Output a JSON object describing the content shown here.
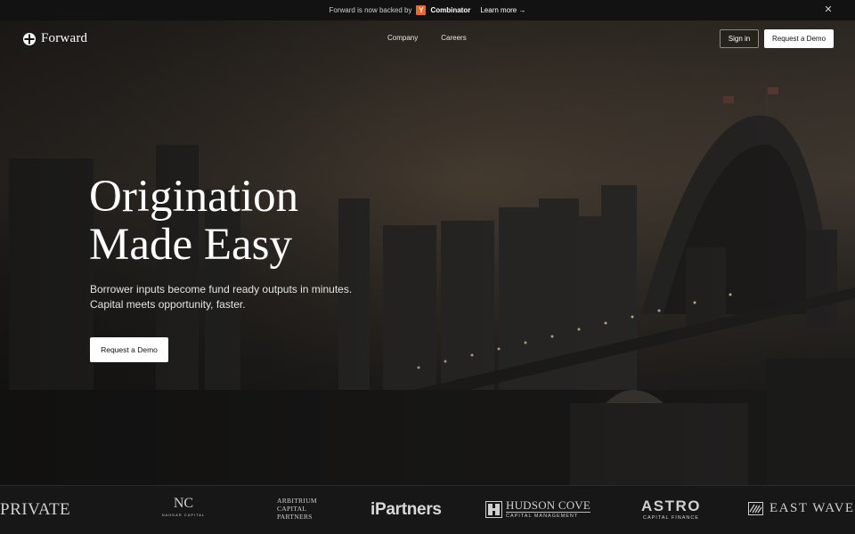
{
  "announcement": {
    "text": "Forward is now backed by",
    "badge": "Y",
    "brand": "Combinator",
    "link": "Learn more →",
    "close_icon": "close-icon"
  },
  "nav": {
    "logo_text": "Forward",
    "logo_icon": "forward-logo-icon",
    "links": [
      "Company",
      "Careers"
    ],
    "sign_in": "Sign in",
    "request_demo": "Request a Demo"
  },
  "hero": {
    "headline": [
      "Origination",
      "Made Easy"
    ],
    "subline": [
      "Borrower inputs become fund ready outputs in minutes.",
      "Capital meets opportunity, faster."
    ],
    "cta": "Request a Demo",
    "background": "city-harbour-bridge-dusk-photo"
  },
  "logos": {
    "private": "PRIVATE",
    "nahdar_mono": "NC",
    "nahdar_sub": "NAHDAR CAPITAL",
    "arbitrium": [
      "ARBITRIUM",
      "CAPITAL",
      "PARTNERS"
    ],
    "ipartners": "iPartners",
    "hudson_1": "HUDSON COVE",
    "hudson_2": "CAPITAL MANAGEMENT",
    "astro_1": "ASTRO",
    "astro_2": "CAPITAL FINANCE",
    "eastwave": "EAST WAVE"
  },
  "colors": {
    "yc_orange": "#f26522",
    "button_bg": "#ffffff",
    "strip_bg": "#171717"
  }
}
